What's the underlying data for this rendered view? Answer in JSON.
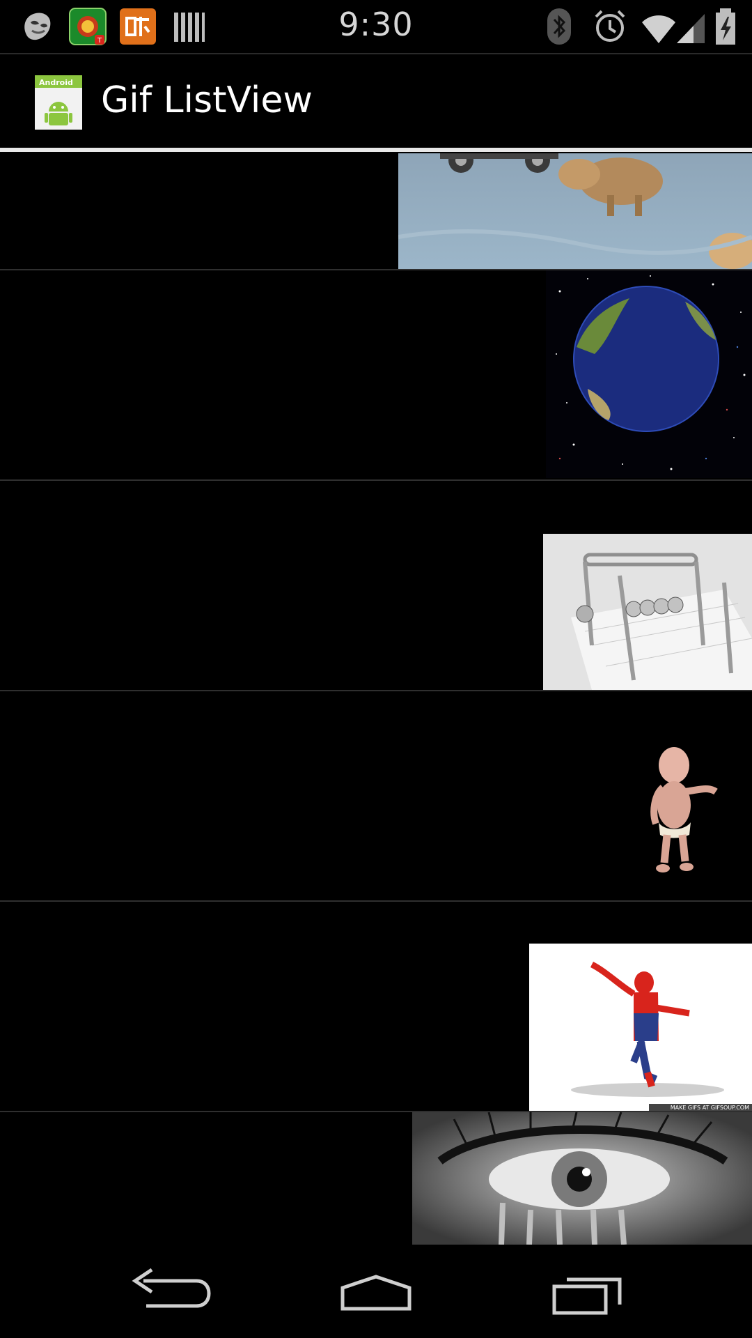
{
  "status_bar": {
    "time": "9:30",
    "left_icons": [
      "mask-icon",
      "game-app-icon",
      "xiami-icon",
      "barcode-icon"
    ],
    "right_icons": [
      "bluetooth-icon",
      "alarm-icon",
      "wifi-icon",
      "signal-icon",
      "battery-charging-icon"
    ]
  },
  "action_bar": {
    "title": "Gif ListView",
    "icon_text": "Android"
  },
  "list": {
    "items": [
      {
        "name": "dogs-gif"
      },
      {
        "name": "earth-gif"
      },
      {
        "name": "newtons-cradle-gif"
      },
      {
        "name": "dancing-baby-gif"
      },
      {
        "name": "spiderman-gif",
        "watermark": "MAKE GIFS AT GIFSOUP.COM"
      },
      {
        "name": "eye-gif"
      }
    ]
  },
  "nav_bar": {
    "buttons": [
      "back-button",
      "home-button",
      "recents-button"
    ]
  }
}
